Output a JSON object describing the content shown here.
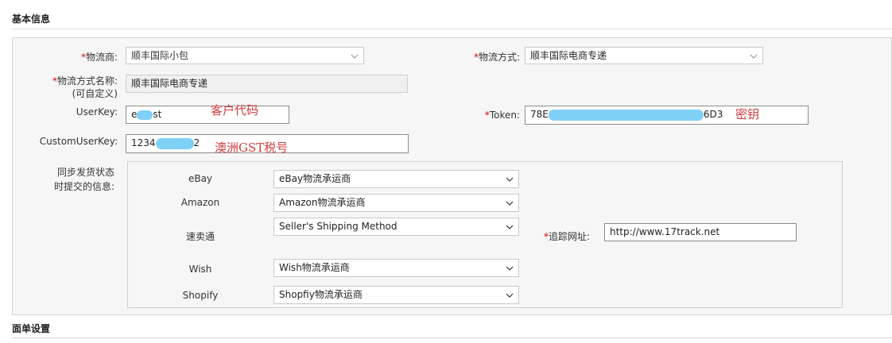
{
  "sections": {
    "basic_info": "基本信息",
    "waybill_settings": "面单设置"
  },
  "form": {
    "carrier": {
      "required_mark": "*",
      "label": "物流商:",
      "value": "顺丰国际小包"
    },
    "method": {
      "required_mark": "*",
      "label": "物流方式:",
      "value": "顺丰国际电商专递"
    },
    "method_name": {
      "required_mark": "*",
      "label_line1": "物流方式名称:",
      "label_line2": "(可自定义)",
      "value": "顺丰国际电商专递"
    },
    "userkey": {
      "label": "UserKey:",
      "value": "e",
      "value_tail": "st",
      "note": "客户代码"
    },
    "token": {
      "required_mark": "*",
      "label": "Token:",
      "value": "78E",
      "value_tail": "6D3",
      "note": "密钥"
    },
    "customuserkey": {
      "label": "CustomUserKey:",
      "value": "1234",
      "value_tail": "2",
      "note": "澳洲GST税号"
    },
    "sync": {
      "label_line1": "同步发货状态",
      "label_line2": "时提交的信息:"
    }
  },
  "platforms": [
    {
      "name": "eBay",
      "value": "eBay物流承运商"
    },
    {
      "name": "Amazon",
      "value": "Amazon物流承运商"
    },
    {
      "name": "速卖通",
      "value": "Seller's Shipping Method"
    },
    {
      "name": "Wish",
      "value": "Wish物流承运商"
    },
    {
      "name": "Shopify",
      "value": "Shopfiy物流承运商"
    }
  ],
  "tracking": {
    "required_mark": "*",
    "label": "追踪网址:",
    "value": "http://www.17track.net"
  },
  "colors": {
    "required": "#dd0000",
    "note": "#d23c3c",
    "redaction": "#7fd0f7"
  }
}
